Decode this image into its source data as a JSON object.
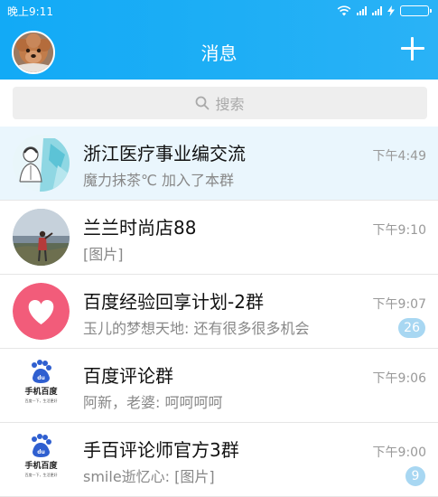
{
  "status_bar": {
    "time": "晚上9:11"
  },
  "header": {
    "title": "消息"
  },
  "search": {
    "placeholder": "搜索"
  },
  "conversations": [
    {
      "name": "浙江医疗事业编交流",
      "preview": "魔力抹茶℃ 加入了本群",
      "time": "下午4:49",
      "badge": ""
    },
    {
      "name": "兰兰时尚店88",
      "preview": "[图片]",
      "time": "下午9:10",
      "badge": ""
    },
    {
      "name": "百度经验回享计划-2群",
      "preview": "玉儿的梦想天地: 还有很多很多机会",
      "time": "下午9:07",
      "badge": "26"
    },
    {
      "name": "百度评论群",
      "preview": "阿新，老婆: 呵呵呵呵",
      "time": "下午9:06",
      "badge": ""
    },
    {
      "name": "手百评论师官方3群",
      "preview": "smile逝忆心: [图片]",
      "time": "下午9:00",
      "badge": "9"
    }
  ],
  "logo_text": {
    "app_name": "手机百度",
    "slogan": "百度一下，生活更好"
  },
  "colors": {
    "header": "#1daef5",
    "badge": "#a8d7f2",
    "pinned_row": "#eaf6fd",
    "heart_bg": "#f25c7a"
  }
}
